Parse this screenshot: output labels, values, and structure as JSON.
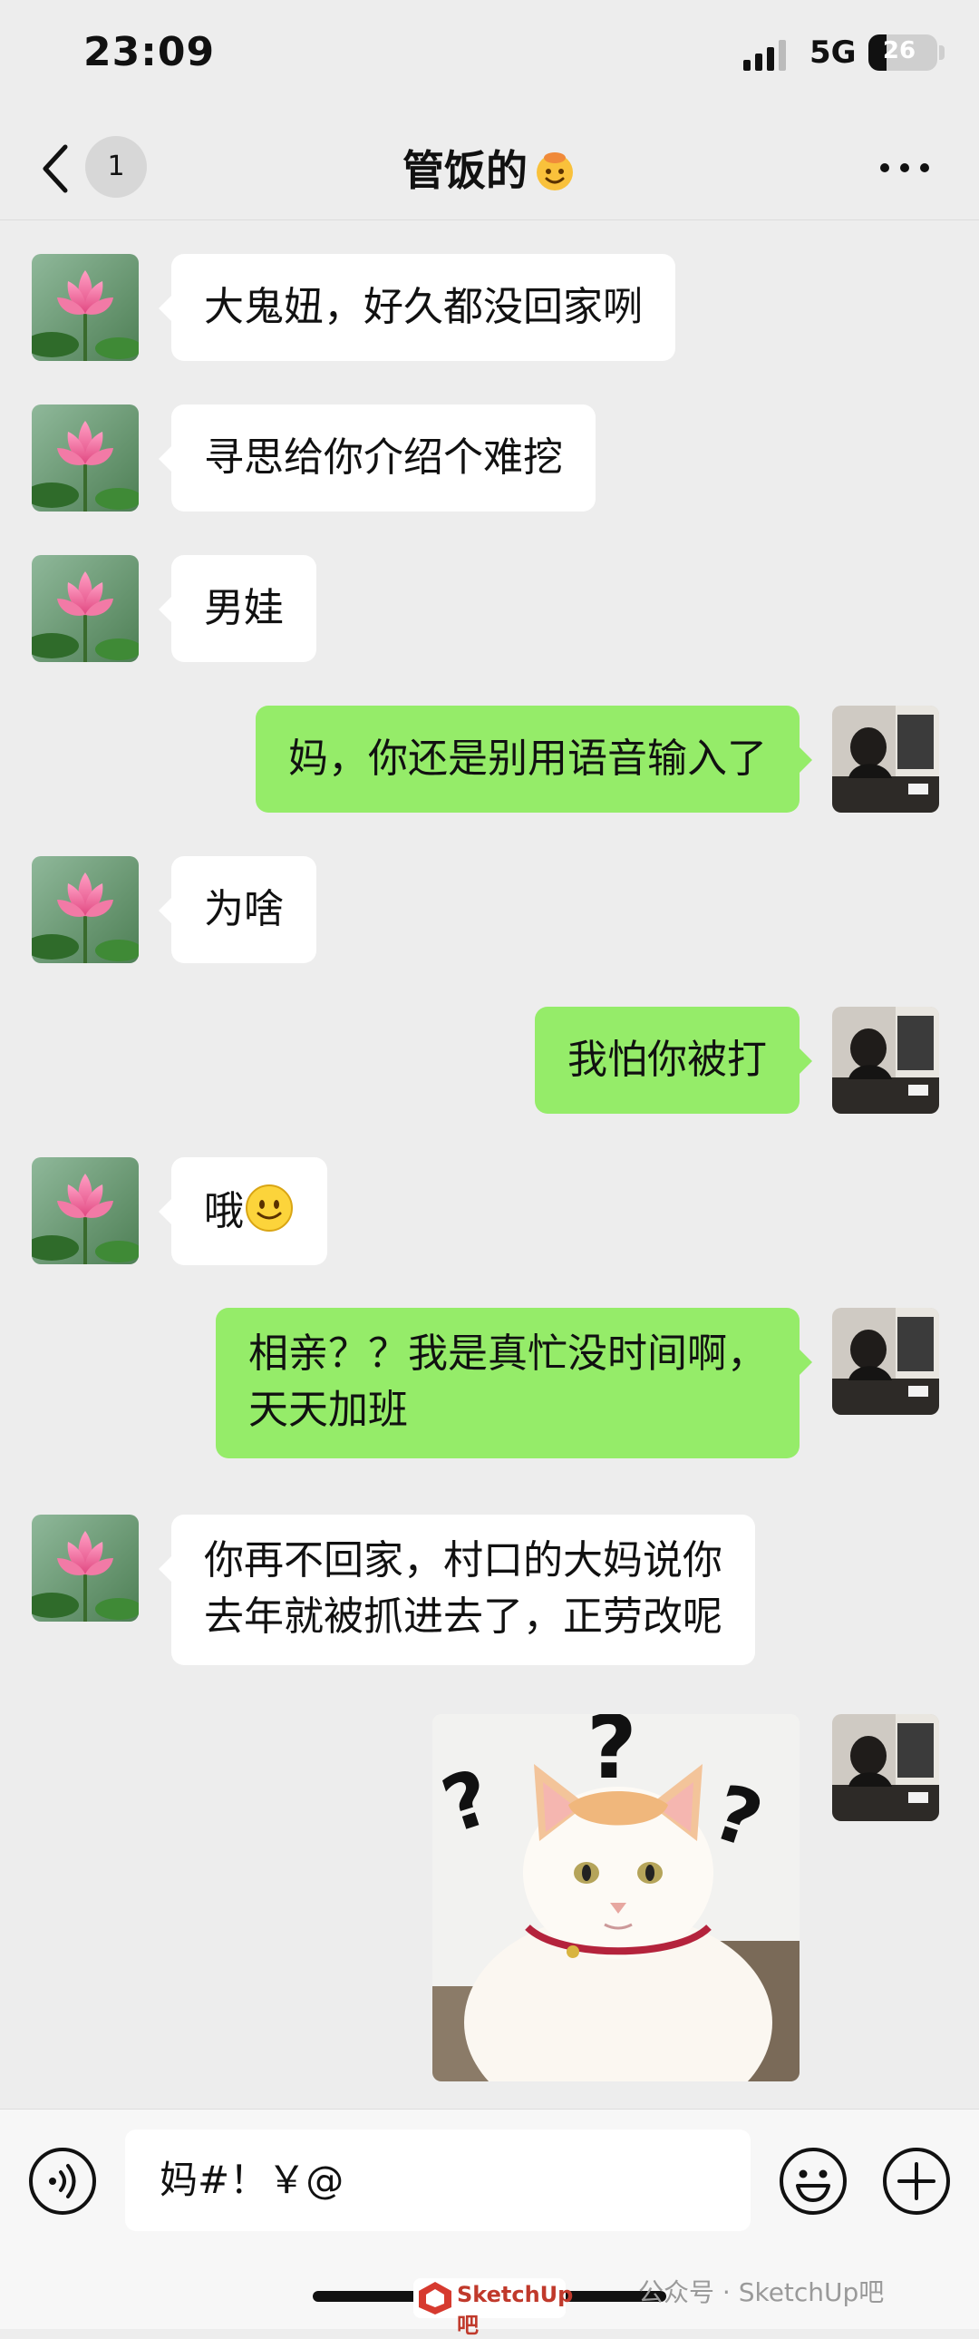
{
  "status": {
    "time": "23:09",
    "network": "5G",
    "battery": "26",
    "battery_level": 0.26
  },
  "nav": {
    "unread_count": "1",
    "title": "管饭的",
    "title_emoji": "smiling-face-icon",
    "more_icon": "more-dots-icon"
  },
  "messages": [
    {
      "side": "in",
      "text": "大鬼妞，好久都没回家咧"
    },
    {
      "side": "in",
      "text": "寻思给你介绍个难挖"
    },
    {
      "side": "in",
      "text": "男娃"
    },
    {
      "side": "out",
      "text": "妈，你还是别用语音输入了"
    },
    {
      "side": "in",
      "text": "为啥"
    },
    {
      "side": "out",
      "text": "我怕你被打"
    },
    {
      "side": "in",
      "text": "哦",
      "emoji": "smile-emoji"
    },
    {
      "side": "out",
      "text": "相亲？？我是真忙没时间啊，\n天天加班"
    },
    {
      "side": "in",
      "text": "你再不回家，村口的大妈说你\n去年就被抓进去了，正劳改呢"
    },
    {
      "side": "out",
      "type": "sticker",
      "sticker": "confused-cat-sticker"
    }
  ],
  "input": {
    "value": "妈#！￥@"
  },
  "watermark": {
    "text": "公众号 · SketchUp吧",
    "logo": "SketchUp吧"
  },
  "colors": {
    "outgoing_bubble": "#95ec69",
    "incoming_bubble": "#ffffff",
    "background": "#ededed"
  }
}
